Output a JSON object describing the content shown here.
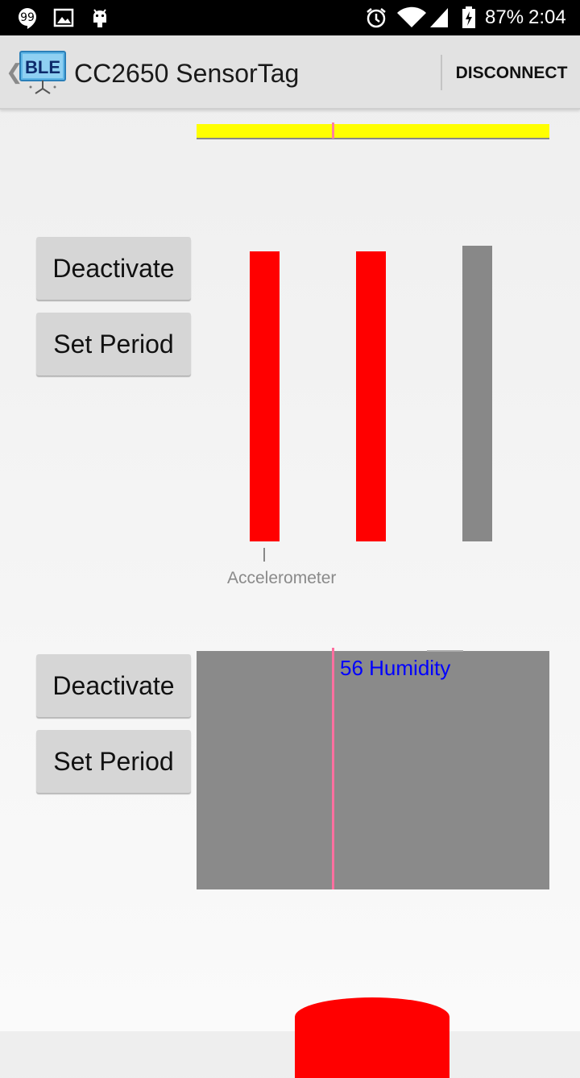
{
  "status_bar": {
    "battery_percent": "87%",
    "time": "2:04",
    "icons": [
      "hangouts-icon",
      "image-icon",
      "android-icon",
      "alarm-icon",
      "wifi-icon",
      "signal-icon",
      "battery-charging-icon"
    ]
  },
  "action_bar": {
    "up_caret": "❮",
    "logo_text": "BLE",
    "title": "CC2650 SensorTag",
    "disconnect_label": "DISCONNECT"
  },
  "accelerometer": {
    "deactivate_label": "Deactivate",
    "set_period_label": "Set Period",
    "sensor_label": "Accelerometer",
    "bar_colors": [
      "#ff0000",
      "#ff0000",
      "#888888"
    ]
  },
  "humidity": {
    "deactivate_label": "Deactivate",
    "set_period_label": "Set Period",
    "reading_label": "56 Humidity",
    "text_color": "#0000ff"
  },
  "colors": {
    "yellow_bar": "#ffff00",
    "marker_pink": "#ff6fa0",
    "dome_red": "#ff0000"
  }
}
